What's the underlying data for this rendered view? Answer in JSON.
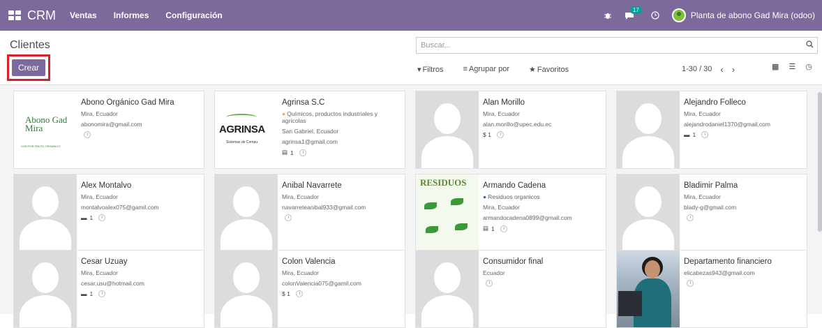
{
  "navbar": {
    "brand": "CRM",
    "menu": [
      "Ventas",
      "Informes",
      "Configuración"
    ],
    "chat_count": "17",
    "company": "Planta de abono Gad Mira (odoo)"
  },
  "control": {
    "breadcrumb": "Clientes",
    "create_label": "Crear",
    "search_placeholder": "Buscar...",
    "filters_label": "Filtros",
    "group_label": "Agrupar por",
    "favorites_label": "Favoritos",
    "pager": "1-30 / 30"
  },
  "cards": [
    {
      "name": "Abono Orgánico Gad Mira",
      "lines": [
        "Mira, Ecuador",
        "abonomira@gmail.com"
      ],
      "meta": "",
      "logo_text": "Abono Gad Mira",
      "logo_sub": "CON POR FRUTO ORGANICO"
    },
    {
      "name": "Agrinsa S.C",
      "category": "Químicos, productos industriales y agrícolas",
      "lines": [
        "San Gabriel, Ecuador",
        "agrinsa1@gmail.com"
      ],
      "meta": "1",
      "logo_text": "AGRINSA",
      "logo_sub": "Sistemas de Compu."
    },
    {
      "name": "Alan Morillo",
      "lines": [
        "Mira, Ecuador",
        "alan.morillo@upec.edu.ec"
      ],
      "meta": "$ 1"
    },
    {
      "name": "Alejandro Folleco",
      "lines": [
        "Mira, Ecuador",
        "alejandrodaniel1370@gmail.com"
      ],
      "meta": "1"
    },
    {
      "name": "Alex Montalvo",
      "lines": [
        "Mira, Ecuador",
        "montalvoalex075@gamil.com"
      ],
      "meta": "1"
    },
    {
      "name": "Anibal Navarrete",
      "lines": [
        "Mira, Ecuador",
        "navarreteanibal933@gmail.com"
      ],
      "meta": ""
    },
    {
      "name": "Armando Cadena",
      "category": "Residuos organicos",
      "lines": [
        "Mira, Ecuador",
        "armandocadena0899@gmail.com"
      ],
      "meta": "1",
      "logo_text": "RESIDUOS"
    },
    {
      "name": "Bladimir Palma",
      "lines": [
        "Mira, Ecuador",
        "blady-g@gmail.com"
      ],
      "meta": ""
    },
    {
      "name": "Cesar Uzuay",
      "lines": [
        "Mira, Ecuador",
        "cesar.usu@hotmail.com"
      ],
      "meta": "1"
    },
    {
      "name": "Colon Valencia",
      "lines": [
        "Mira, Ecuador",
        "colonValencia075@gamil.com"
      ],
      "meta": "$ 1"
    },
    {
      "name": "Consumidor final",
      "lines": [
        "Ecuador"
      ],
      "meta": ""
    },
    {
      "name": "Departamento financiero",
      "lines": [
        "elicabezas943@gmail.com"
      ],
      "meta": ""
    }
  ],
  "colors": {
    "navbar": "#7c6a9c",
    "create_border": "#d9202a"
  },
  "icons": [
    "apps-icon",
    "bug-icon",
    "chat-icon",
    "clock-icon",
    "search-icon",
    "kanban-view-icon",
    "list-view-icon",
    "activity-view-icon"
  ]
}
